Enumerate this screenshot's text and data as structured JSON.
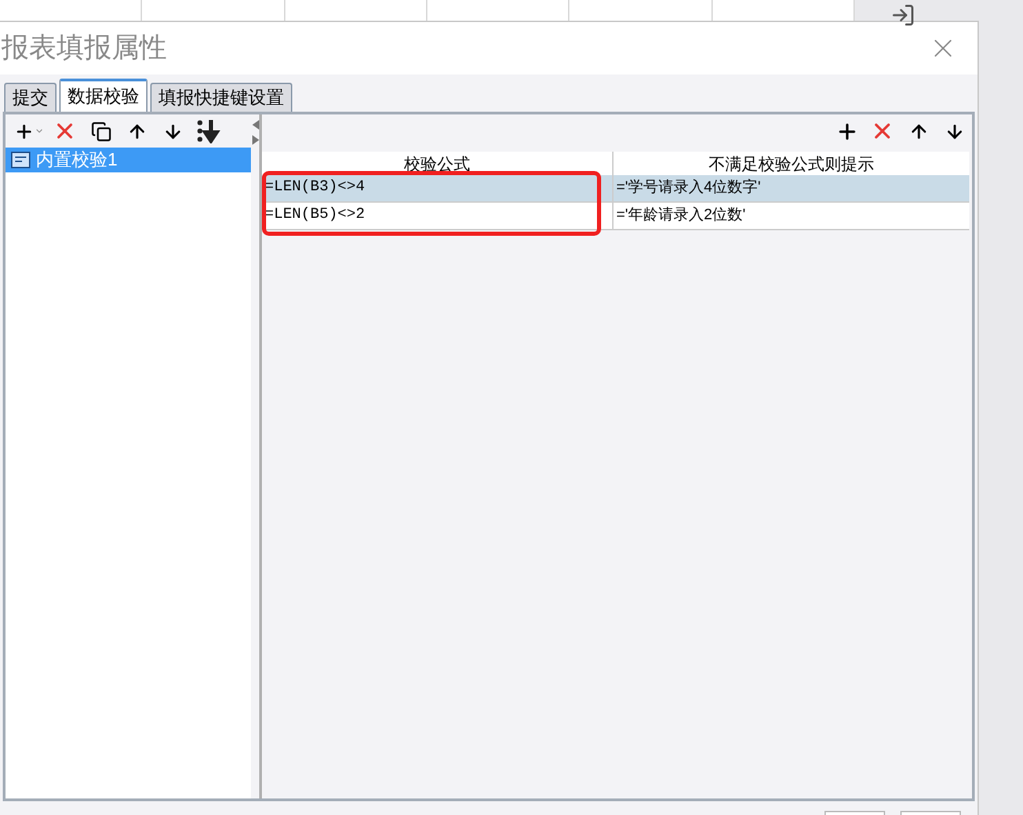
{
  "window": {
    "title": "报表填报属性"
  },
  "tabs": [
    {
      "label": "提交",
      "selected": false
    },
    {
      "label": "数据校验",
      "selected": true
    },
    {
      "label": "填报快捷键设置",
      "selected": false
    }
  ],
  "sidebar": {
    "items": [
      {
        "label": "内置校验1",
        "selected": true
      }
    ]
  },
  "table": {
    "columns": [
      "校验公式",
      "不满足校验公式则提示"
    ],
    "rows": [
      {
        "cells": [
          "=LEN(B3)<>4",
          "='学号请录入4位数字'"
        ],
        "selected": true
      },
      {
        "cells": [
          "=LEN(B5)<>2",
          "='年龄请录入2位数'"
        ],
        "selected": false
      }
    ]
  }
}
